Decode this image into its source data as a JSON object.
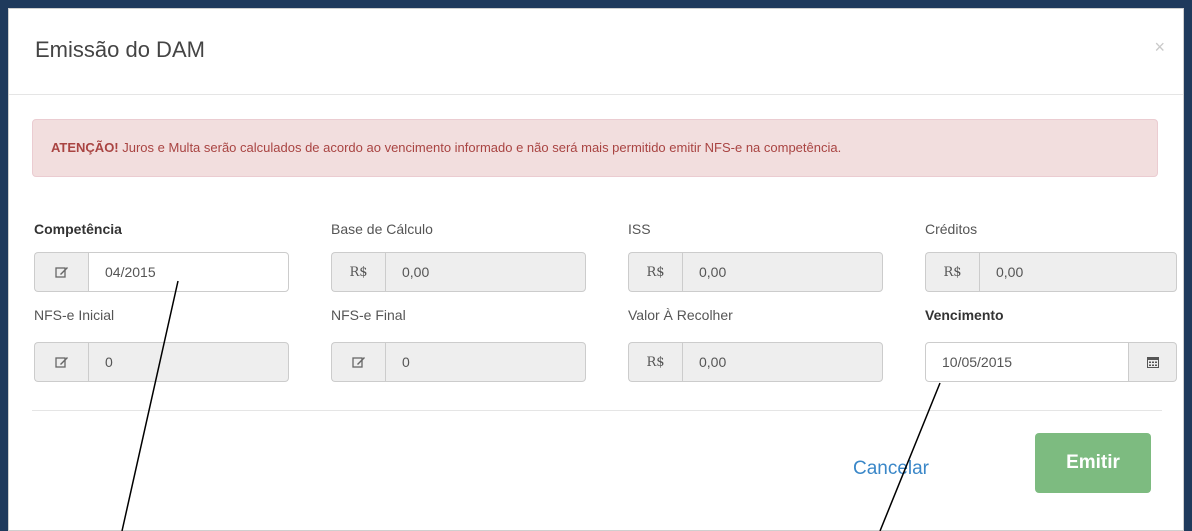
{
  "modal": {
    "title": "Emissão do DAM",
    "close_icon": "×"
  },
  "alert": {
    "strong": "ATENÇÃO!",
    "text": " Juros e Multa serão calculados de acordo ao vencimento informado e não será mais permitido emitir NFS-e na competência."
  },
  "fields": {
    "competencia": {
      "label": "Competência",
      "icon": "edit-icon",
      "value": "04/2015"
    },
    "base_calculo": {
      "label": "Base de Cálculo",
      "addon": "R$",
      "value": "0,00"
    },
    "iss": {
      "label": "ISS",
      "addon": "R$",
      "value": "0,00"
    },
    "creditos": {
      "label": "Créditos",
      "addon": "R$",
      "value": "0,00"
    },
    "nfse_inicial": {
      "label": "NFS-e Inicial",
      "icon": "edit-icon",
      "value": "0"
    },
    "nfse_final": {
      "label": "NFS-e Final",
      "icon": "edit-icon",
      "value": "0"
    },
    "valor_recolher": {
      "label": "Valor À Recolher",
      "addon": "R$",
      "value": "0,00"
    },
    "vencimento": {
      "label": "Vencimento",
      "icon": "calendar-icon",
      "value": "10/05/2015"
    }
  },
  "buttons": {
    "cancel": "Cancelar",
    "emit": "Emitir"
  }
}
